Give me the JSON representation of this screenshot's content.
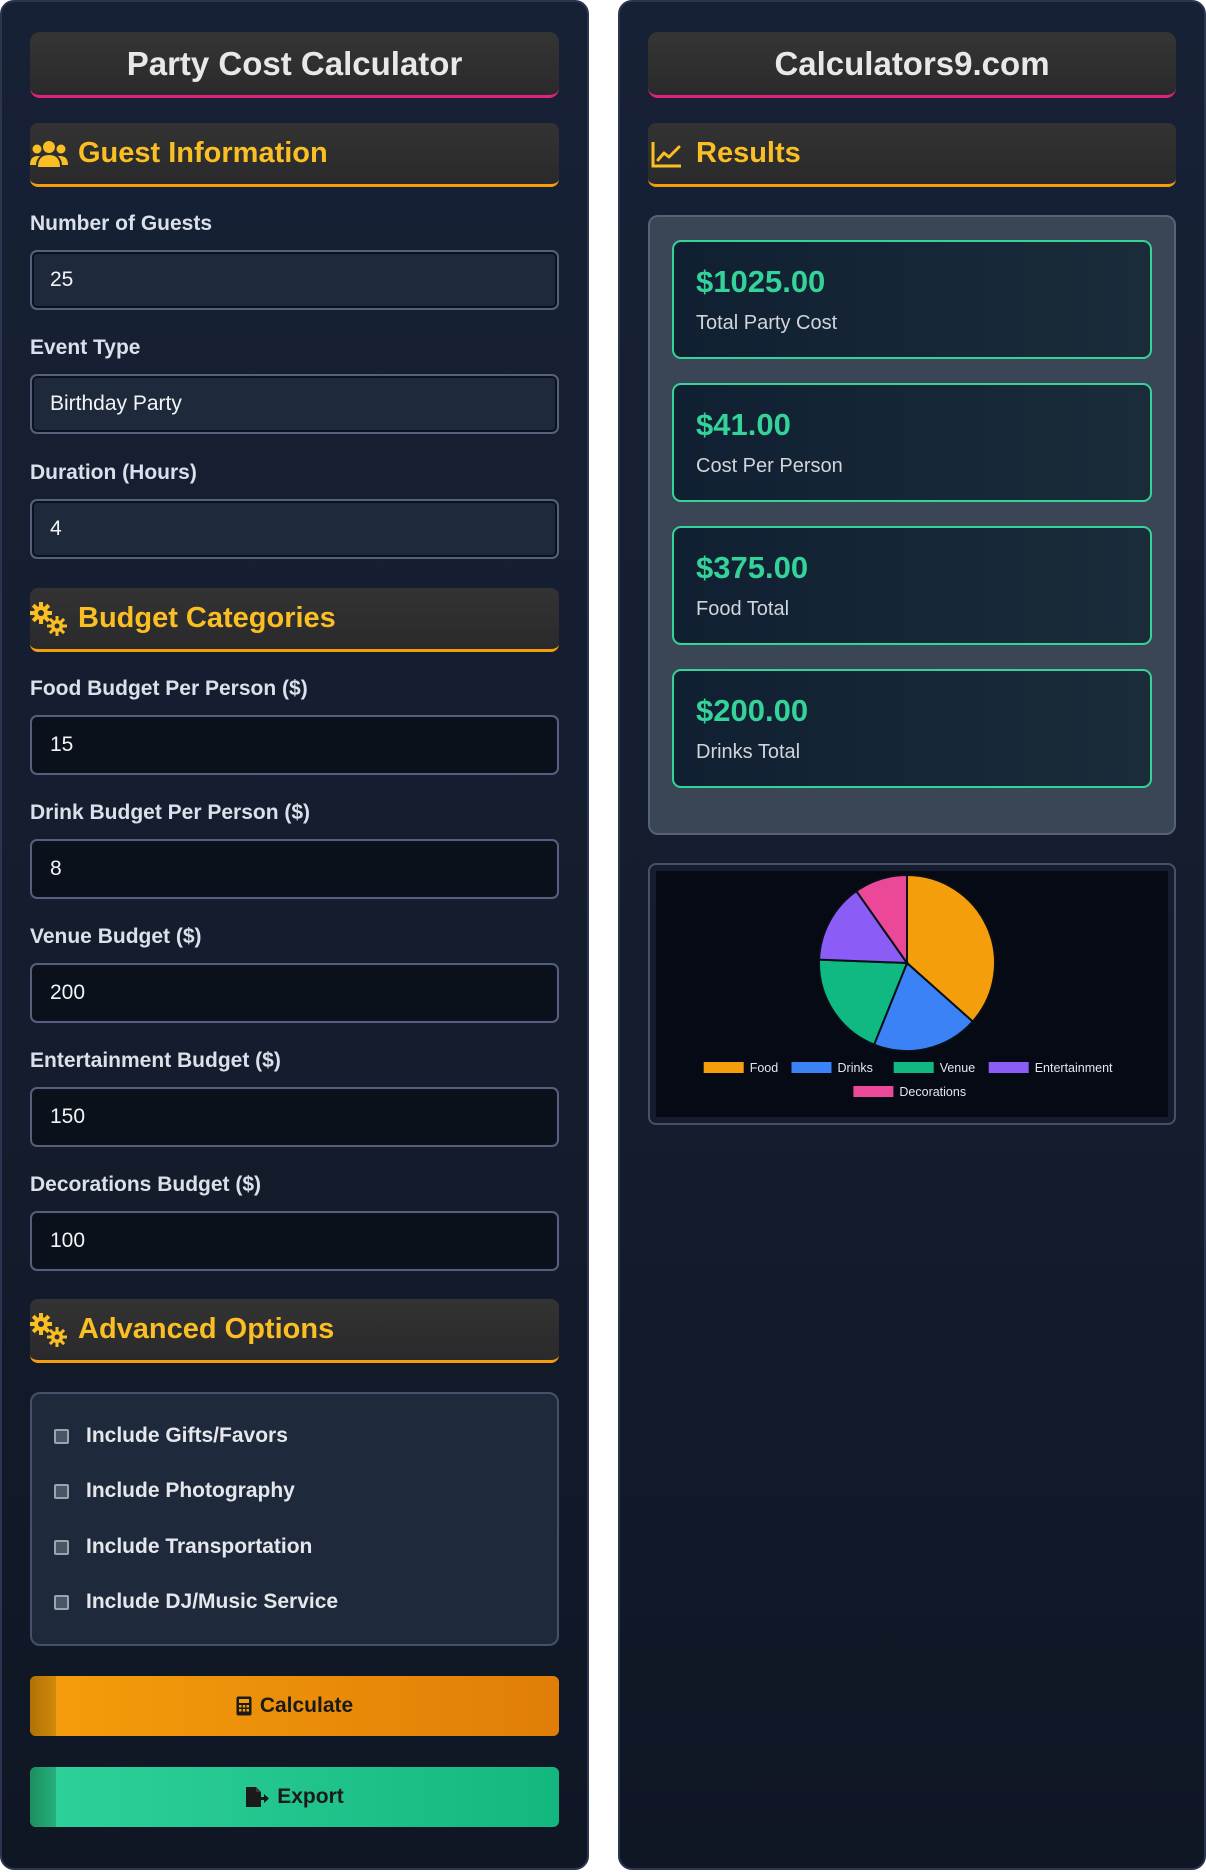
{
  "left": {
    "title": "Party Cost Calculator",
    "guest_section": "Guest Information",
    "fields": [
      {
        "label": "Number of Guests",
        "value": "25"
      },
      {
        "label": "Event Type",
        "value": "Birthday Party"
      },
      {
        "label": "Duration (Hours)",
        "value": "4"
      }
    ],
    "budget_section": "Budget Categories",
    "budget_fields": [
      {
        "label": "Food Budget Per Person ($)",
        "value": "15"
      },
      {
        "label": "Drink Budget Per Person ($)",
        "value": "8"
      },
      {
        "label": "Venue Budget ($)",
        "value": "200"
      },
      {
        "label": "Entertainment Budget ($)",
        "value": "150"
      },
      {
        "label": "Decorations Budget ($)",
        "value": "100"
      }
    ],
    "advanced_section": "Advanced Options",
    "options": [
      {
        "label": "Include Gifts/Favors",
        "checked": false
      },
      {
        "label": "Include Photography",
        "checked": false
      },
      {
        "label": "Include Transportation",
        "checked": false
      },
      {
        "label": "Include DJ/Music Service",
        "checked": false
      }
    ],
    "calculate_label": "Calculate",
    "export_label": "Export"
  },
  "right": {
    "title": "Calculators9.com",
    "results_section": "Results",
    "results": [
      {
        "value": "$1025.00",
        "label": "Total Party Cost"
      },
      {
        "value": "$41.00",
        "label": "Cost Per Person"
      },
      {
        "value": "$375.00",
        "label": "Food Total"
      },
      {
        "value": "$200.00",
        "label": "Drinks Total"
      }
    ]
  },
  "colors": {
    "accent_title": "#e0237a",
    "accent_section": "#f59e0b",
    "section_text": "#fbbf24",
    "result_green": "#34d399"
  },
  "chart_data": {
    "type": "pie",
    "categories": [
      "Food",
      "Drinks",
      "Venue",
      "Entertainment",
      "Decorations"
    ],
    "values": [
      375,
      200,
      200,
      150,
      100
    ],
    "colors": [
      "#f59e0b",
      "#3b82f6",
      "#10b981",
      "#8b5cf6",
      "#ec4899"
    ],
    "legend": "bottom"
  }
}
